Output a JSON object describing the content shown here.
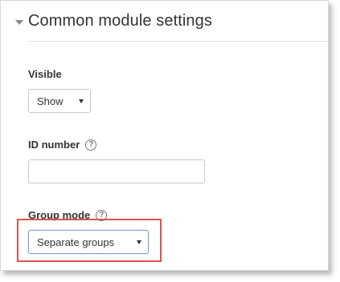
{
  "section": {
    "title": "Common module settings"
  },
  "visible": {
    "label": "Visible",
    "selected": "Show"
  },
  "id_number": {
    "label": "ID number",
    "value": ""
  },
  "group_mode": {
    "label": "Group mode",
    "selected": "Separate groups"
  },
  "colors": {
    "highlight": "#d9534f",
    "text": "#333333"
  },
  "icons": {
    "collapse": "triangle-down-icon",
    "help": "question-circle-icon"
  }
}
